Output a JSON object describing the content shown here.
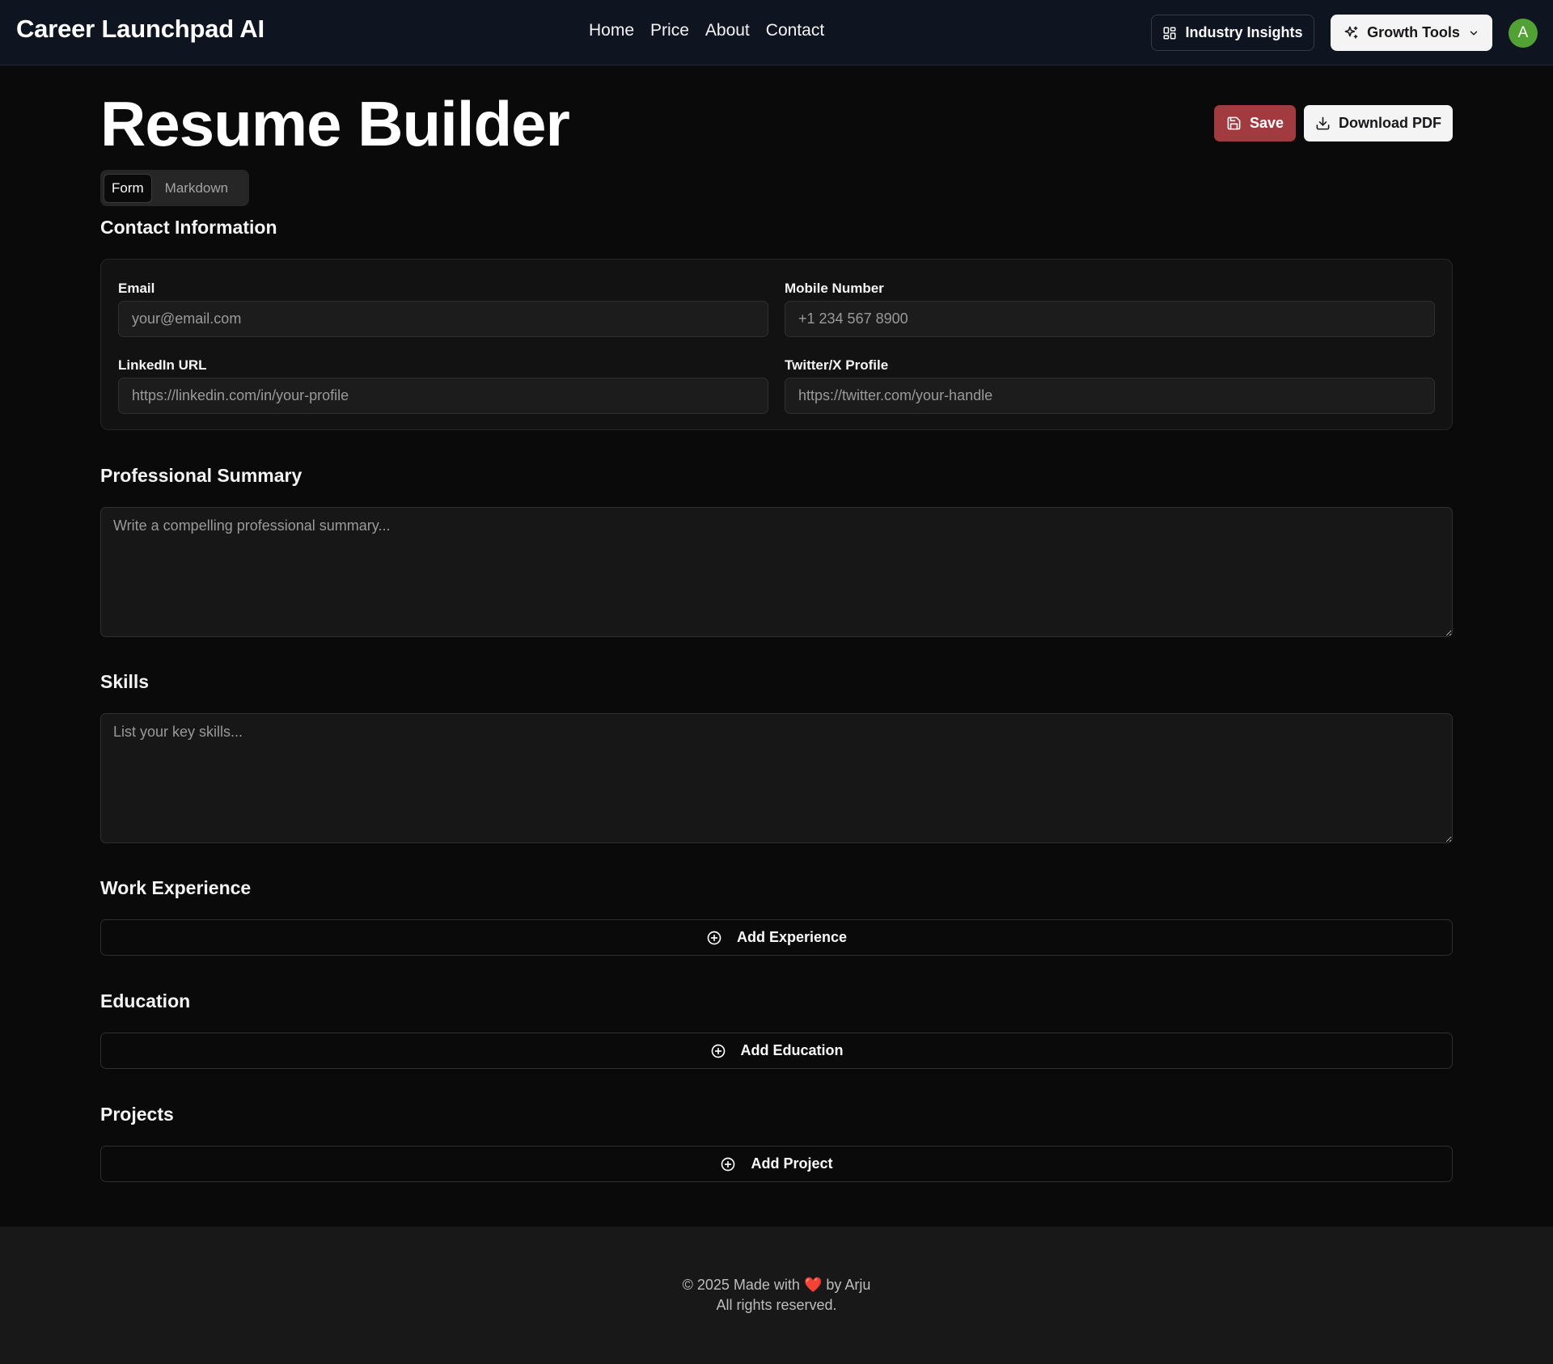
{
  "header": {
    "brand": "Career Launchpad AI",
    "nav": [
      "Home",
      "Price",
      "About",
      "Contact"
    ],
    "insights_label": "Industry Insights",
    "growth_label": "Growth Tools",
    "avatar_initial": "A"
  },
  "main": {
    "title": "Resume Builder",
    "save_label": "Save",
    "download_label": "Download PDF",
    "tabs": [
      "Form",
      "Markdown"
    ],
    "contact": {
      "title": "Contact Information",
      "email_label": "Email",
      "email_placeholder": "your@email.com",
      "mobile_label": "Mobile Number",
      "mobile_placeholder": "+1 234 567 8900",
      "linkedin_label": "LinkedIn URL",
      "linkedin_placeholder": "https://linkedin.com/in/your-profile",
      "twitter_label": "Twitter/X Profile",
      "twitter_placeholder": "https://twitter.com/your-handle"
    },
    "summary": {
      "title": "Professional Summary",
      "placeholder": "Write a compelling professional summary..."
    },
    "skills": {
      "title": "Skills",
      "placeholder": "List your key skills..."
    },
    "experience": {
      "title": "Work Experience",
      "add_label": "Add Experience"
    },
    "education": {
      "title": "Education",
      "add_label": "Add Education"
    },
    "projects": {
      "title": "Projects",
      "add_label": "Add Project"
    }
  },
  "footer": {
    "line1_prefix": "© 2025 Made with",
    "heart": "❤️",
    "line1_suffix": "by Arju",
    "line2": "All rights reserved."
  },
  "colors": {
    "background": "#0a0a0a",
    "header_bg": "#0f1421",
    "save_button": "#a23b3f",
    "avatar": "#52a135"
  }
}
